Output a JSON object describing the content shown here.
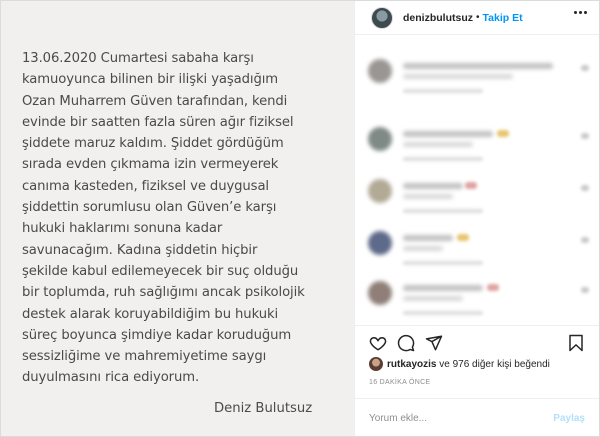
{
  "statement": {
    "lines": [
      "13.06.2020 Cumartesi sabaha karşı",
      "kamuoyunca bilinen bir ilişki yaşadığım",
      "Ozan Muharrem Güven tarafından, kendi",
      "evinde bir saatten fazla süren ağır fiziksel",
      "şiddete maruz kaldım. Şiddet gördüğüm",
      "sırada evden çıkmama izin vermeyerek",
      "canıma kasteden, fiziksel ve duygusal",
      "şiddettin sorumlusu olan Güven’e karşı",
      "hukuki haklarımı sonuna kadar",
      "savunacağım. Kadına şiddetin hiçbir",
      "şekilde kabul edilemeyecek bir suç olduğu",
      "bir toplumda, ruh sağlığımı ancak psikolojik",
      "destek alarak koruyabildiğim bu hukuki",
      "süreç boyunca şimdiye kadar koruduğum",
      "sessizliğime ve mahremiyetime saygı",
      "duyulmasını rica ediyorum."
    ],
    "signature": "Deniz Bulutsuz"
  },
  "header": {
    "username": "denizbulutsuz",
    "separator": "•",
    "follow_label": "Takip Et",
    "more_icon": "more-horizontal-icon"
  },
  "actions": {
    "like_icon": "heart-icon",
    "comment_icon": "comment-icon",
    "share_icon": "paper-plane-icon",
    "save_icon": "bookmark-icon"
  },
  "likes": {
    "liker": "rutkayozis",
    "rest": " ve 976 diğer kişi beğendi"
  },
  "timestamp": "16 DAKİKA ÖNCE",
  "comment_box": {
    "placeholder": "Yorum ekle...",
    "share_label": "Paylaş"
  },
  "colors": {
    "accent": "#0095f6",
    "share_disabled": "#b2dffc",
    "image_background": "#f1f0ee",
    "statement_text": "#4a4a4a"
  }
}
